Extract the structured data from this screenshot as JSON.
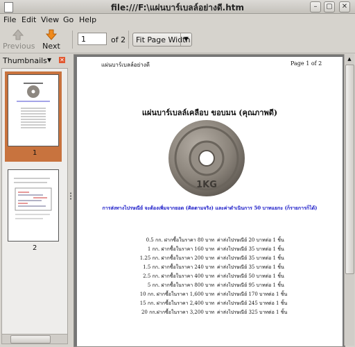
{
  "window": {
    "title": "file:///F:\\แผ่นบาร์เบลล์อย่างดี.htm"
  },
  "menu": [
    "File",
    "Edit",
    "View",
    "Go",
    "Help"
  ],
  "toolbar": {
    "previous_label": "Previous",
    "next_label": "Next",
    "page_value": "1",
    "of_label": "of 2",
    "zoom_value": "Fit Page Width"
  },
  "sidebar": {
    "title": "Thumbnails",
    "thumbs": [
      {
        "label": "1"
      },
      {
        "label": "2"
      }
    ]
  },
  "document": {
    "header_left": "แผ่นบาร์เบลล์อย่างดี",
    "header_right": "Page 1 of 2",
    "title": "แผ่นบาร์เบลล์เคลือบ ขอบมน (คุณภาพดี)",
    "plate_text": "1KG",
    "shipping_note": "การส่งทางไปรษณีย์ จะต้องเพิ่มจากยอด (คิดตามจริง) และค่าดำเนินการ 50 บาทแยกะ (ก็รายการก็ได้)",
    "prices": [
      {
        "item": "0.5 กก. ฝากซื้อในราคา 80 บาท",
        "ship": "ค่าส่งไปรษณีย์ 20 บาทต่อ 1 ชิ้น"
      },
      {
        "item": "1 กก. ฝากซื้อในราคา 160 บาท",
        "ship": "ค่าส่งไปรษณีย์ 35 บาทต่อ 1 ชิ้น"
      },
      {
        "item": "1.25 กก. ฝากซื้อในราคา 200 บาท",
        "ship": "ค่าส่งไปรษณีย์ 35 บาทต่อ 1 ชิ้น"
      },
      {
        "item": "1.5 กก. ฝากซื้อในราคา 240 บาท",
        "ship": "ค่าส่งไปรษณีย์ 35 บาทต่อ 1 ชิ้น"
      },
      {
        "item": "2.5 กก. ฝากซื้อในราคา 400 บาท",
        "ship": "ค่าส่งไปรษณีย์ 50 บาทต่อ 1 ชิ้น"
      },
      {
        "item": "5 กก. ฝากซื้อในราคา 800 บาท",
        "ship": "ค่าส่งไปรษณีย์ 95 บาทต่อ 1 ชิ้น"
      },
      {
        "item": "10 กก. ฝากซื้อในราคา 1,600 บาท",
        "ship": "ค่าส่งไปรษณีย์ 170 บาทต่อ 1 ชิ้น"
      },
      {
        "item": "15 กก. ฝากซื้อในราคา 2,400 บาท",
        "ship": "ค่าส่งไปรษณีย์ 245 บาทต่อ 1 ชิ้น"
      },
      {
        "item": "20 กก.ฝากซื้อในราคา 3,200 บาท",
        "ship": "ค่าส่งไปรษณีย์ 325 บาทต่อ 1 ชิ้น"
      }
    ]
  },
  "colors": {
    "accent_selection": "#c8733e",
    "close_icon": "#e2572f",
    "link_blue": "#1a1ac8"
  }
}
